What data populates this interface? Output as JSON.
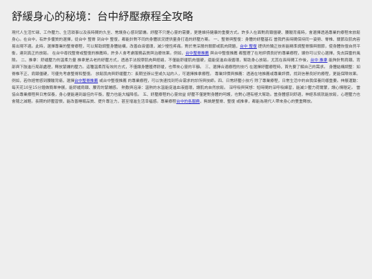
{
  "article": {
    "title": "舒緩身心的秘境：台中紓壓療程全攻略",
    "paragraph": [
      {
        "type": "text",
        "text": "現代人生活忙碌、工作壓力、生活瑣事以及長時間的久坐、常讓身心感到緊繃。紓壓不只是心靈的需要，更是維持健康的重要方式。許多人在面對肩頸僵硬、腰酸背痛時，會選擇透過專業的療程來放鬆身心。在台中，有許多優質的選擇，從台中 整脊 到台中 整復，都能針對不同的身體狀況提供量身打造的紓壓方案。 一、整脊與整復：身體的紓壓基石 當我們長時間保持同一姿勢、脊椎、關節及肌肉容易出現不適。此時，選擇專業的整脊療程，可以幫助調整身體結構，改善血液循環，減少慢性疼痛。對於常深層的關節或肌肉問題，"
      },
      {
        "type": "link",
        "text": "台中 整復"
      },
      {
        "type": "text",
        "text": " 提供的矯正技術能精準調整脊骼與關節，使身體恢復自然平衡，達到真正的放鬆。 在台中尋找整脊或整復的推薦時，許多人會考慮服務品質與治療效果。例如，"
      },
      {
        "type": "link",
        "text": "台中整脊推薦"
      },
      {
        "type": "text",
        "text": " 與台中整復推薦 都整理了在地評價良好的專業療程，讓你可以安心選擇，免去踩雷的風險。 二、推拿：舒緩壓力的溫柔力量 推拿是古老的紓壓方式，透過手法按摩肌肉與經絡，不僅能舒緩肌肉僵硬，還能促進血液循環，幫助身心放鬆。尤其在長時間工作後，"
      },
      {
        "type": "link",
        "text": "台中 推拿"
      },
      {
        "type": "text",
        "text": " 能夠針對肩頸、背部與下肢進行局部處理，釋放緊繃的壓力。這種溫柔而有效的方式，不僅讓身體獲得舒緩，也帶來心靈的平靜。 三、選擇合適療程的技巧 在選擇紓壓療程時，首先要了解自己的需求。 身體結構調整：如脊椎不正、肩頸僵硬，可優先考慮整脊和整復。 放鬆肌肉與舒緩壓力：長期坐辦公室或久站的人，可選擇推拿療程。 專業評價與推薦：透過在地推薦或專業評價，找到信譽良好的療程，更能保障效果。 例如，若你經常感到腰酸背痛，選擇"
      },
      {
        "type": "link",
        "text": "台中整脊推薦"
      },
      {
        "type": "text",
        "text": " 或台中整復推薦 的專業療程，可以快速找到符合需求的診所與技師。四、日常紓壓小技巧 除了專業療程，日常生活中的自我保養同樣重要。伸展運動：每天花10至15分鐘做簡單伸展，能舒緩肩頸、腰背的緊繃感。 熱敷與泡澡：溫熱的水溫能促進血液循環，讓肌肉自然放鬆。 深呼吸與冥想：短時間的深呼吸練習，能減少壓力荷爾蒙，讓心情穩定。 當協合專業療程與日常保養，身心便能達到最佳的平衡，壓力也能大幅降低。 五、紓壓療程的心靈效益 紓壓不僅是對身體的呵護，也對心理有極大幫助。當身體感到舒適，神經系統就能放鬆，心理壓力也會隨之減輕。長期的紓壓習慣，能改善睡眠品質、提升專注力，甚至增進生活幸福感。專業療程"
      },
      {
        "type": "link",
        "text": "台中的各服務"
      },
      {
        "type": "text",
        "text": "，無論是整脊、整復 或推拿，都能為現代人帶來身心的雙重釋放。"
      }
    ]
  },
  "colors": {
    "background": "#eeeeee",
    "title": "#222222",
    "text": "#444444",
    "link": "#2222cc"
  }
}
